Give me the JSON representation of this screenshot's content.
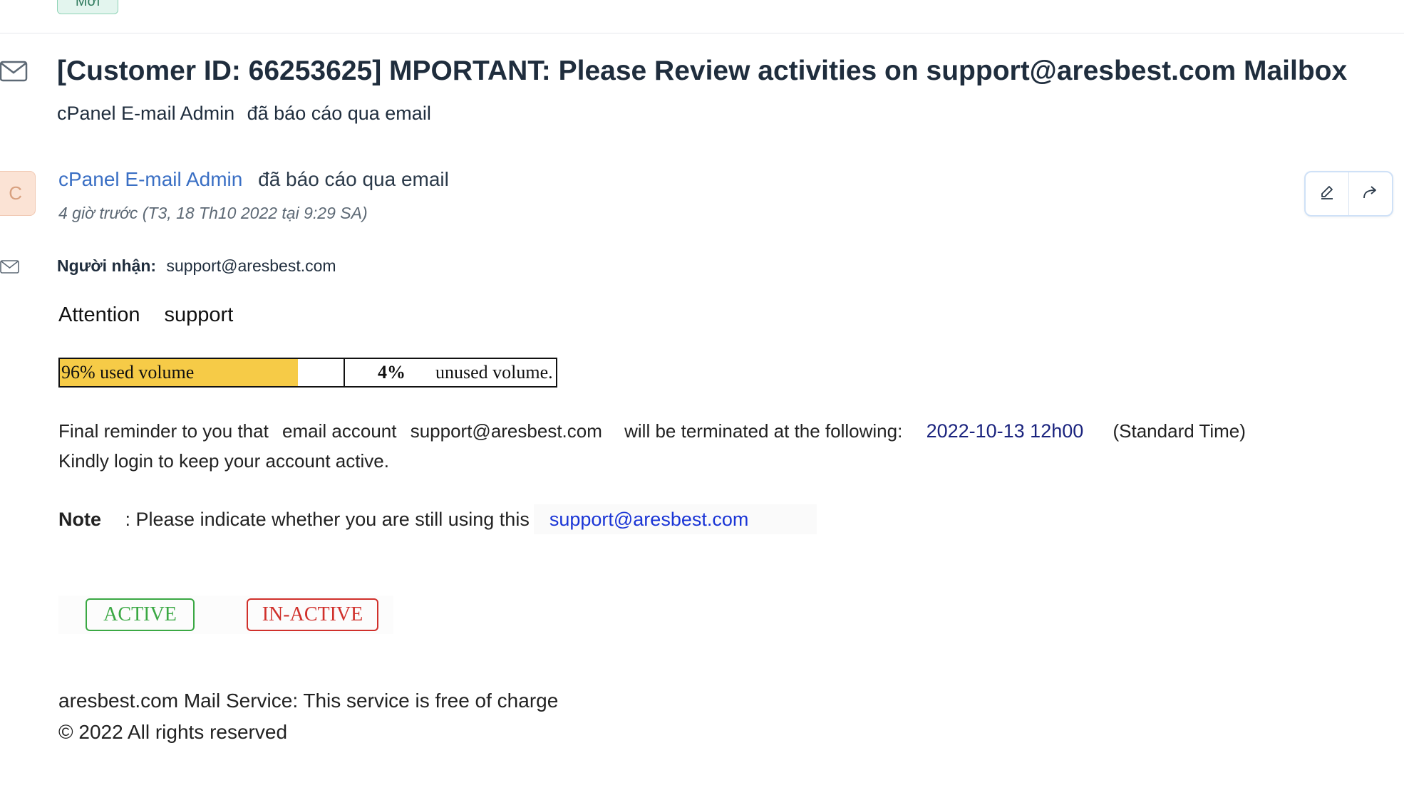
{
  "badge": {
    "label": "Mới"
  },
  "email": {
    "subject": "[Customer ID: 66253625] MPORTANT: Please Review activities on support@aresbest.com Mailbox",
    "reporter_name": "cPanel E-mail Admin",
    "reported_via": "đã báo cáo qua email",
    "sender_name": "cPanel E-mail Admin",
    "sender_action": "đã báo cáo qua email",
    "timestamp": "4 giờ trước (T3, 18 Th10 2022 tại 9:29 SA)",
    "recipient_label": "Người nhận:",
    "recipient_value": "support@aresbest.com"
  },
  "actions": {
    "edit_icon": "pencil-icon",
    "forward_icon": "forward-arrow-icon"
  },
  "body": {
    "attention_word": "Attention",
    "attention_name": "support",
    "usage": {
      "used_fraction": 0.96,
      "used_label": "96% used volume",
      "unused_pct": "4%",
      "unused_label": "unused volume.",
      "fill_color": "#f6cb47"
    },
    "reminder_pre": "Final reminder to you that",
    "reminder_account_label": "email account",
    "reminder_account": "support@aresbest.com",
    "reminder_mid": "will be terminated at the following:",
    "reminder_date": "2022-10-13 12h00",
    "reminder_zone": "(Standard Time)",
    "reminder_line2": "Kindly login to keep your account active.",
    "note_label": "Note",
    "note_text": ": Please indicate whether you are still using this",
    "note_link": "support@aresbest.com",
    "btn_active": "ACTIVE",
    "btn_inactive": "IN-ACTIVE",
    "footer_line1": "aresbest.com Mail Service: This service is free of charge",
    "footer_line2": "© 2022 All rights reserved"
  },
  "colors": {
    "accent_blue": "#3a6fc4",
    "active_green": "#3aa843",
    "inactive_red": "#d0302b",
    "link_blue": "#1a35d6"
  }
}
